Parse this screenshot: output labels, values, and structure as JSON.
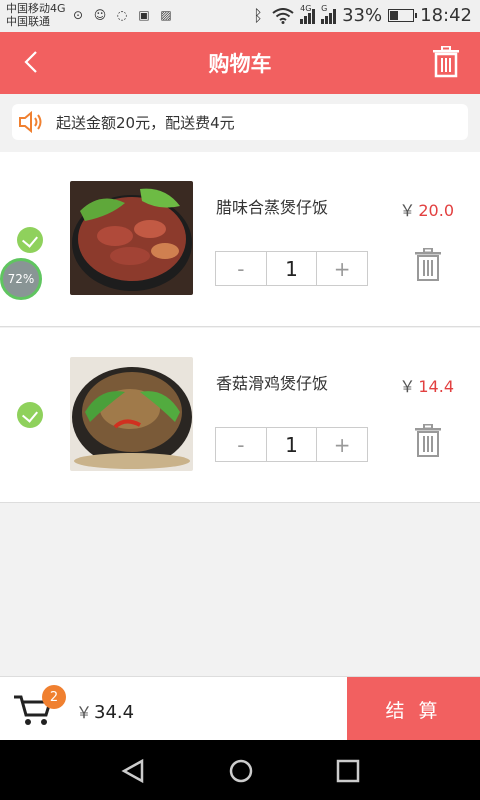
{
  "status_bar": {
    "carrier_line1": "中国移动4G",
    "carrier_line2": "中国联通",
    "net_4g": "4G",
    "net_g": "G",
    "battery": "33%",
    "time": "18:42"
  },
  "header": {
    "title": "购物车"
  },
  "notice": {
    "text": "起送金额20元，配送费4元"
  },
  "cart_items": [
    {
      "name": "腊味合蒸煲仔饭",
      "currency": "￥",
      "price": "20.0",
      "quantity": "1",
      "minus": "-",
      "plus": "+",
      "checked": true
    },
    {
      "name": "香菇滑鸡煲仔饭",
      "currency": "￥",
      "price": "14.4",
      "quantity": "1",
      "minus": "-",
      "plus": "+",
      "checked": true
    }
  ],
  "floating_badge": {
    "text": "72%"
  },
  "footer": {
    "cart_count": "2",
    "currency": "￥",
    "total": "34.4",
    "checkout_label": "结 算"
  },
  "colors": {
    "accent": "#f26060",
    "price": "#e24040",
    "check": "#8fd15c",
    "badge": "#f08030"
  }
}
